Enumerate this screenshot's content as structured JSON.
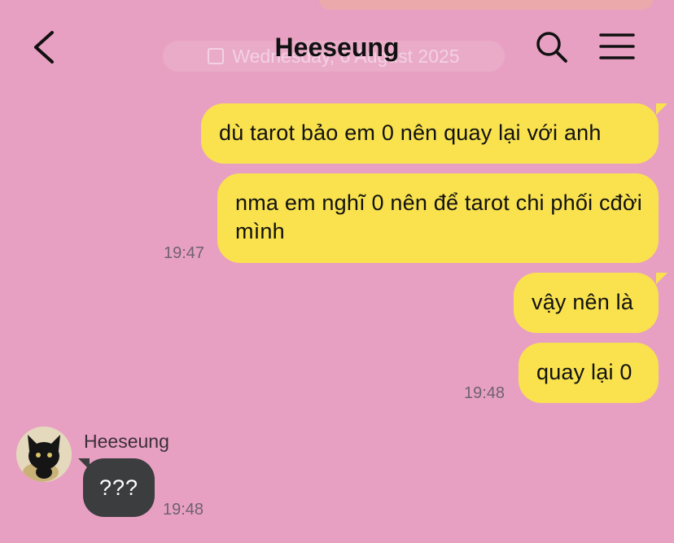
{
  "header": {
    "title": "Heeseung",
    "date_divider": "Wednesday, 6 August 2025"
  },
  "messages": [
    {
      "text": "dù tarot bảo em 0 nên quay lại với anh"
    },
    {
      "text": "nma em nghĩ 0 nên để tarot chi phối cđời mình",
      "time": "19:47"
    },
    {
      "text": "vậy nên là"
    },
    {
      "text": "quay lại 0",
      "time": "19:48"
    }
  ],
  "reply": {
    "sender": "Heeseung",
    "text": "???",
    "time": "19:48"
  },
  "colors": {
    "background": "#e8a0c2",
    "outgoing_bubble": "#f9e24e",
    "incoming_bubble": "#3b3d3e"
  }
}
